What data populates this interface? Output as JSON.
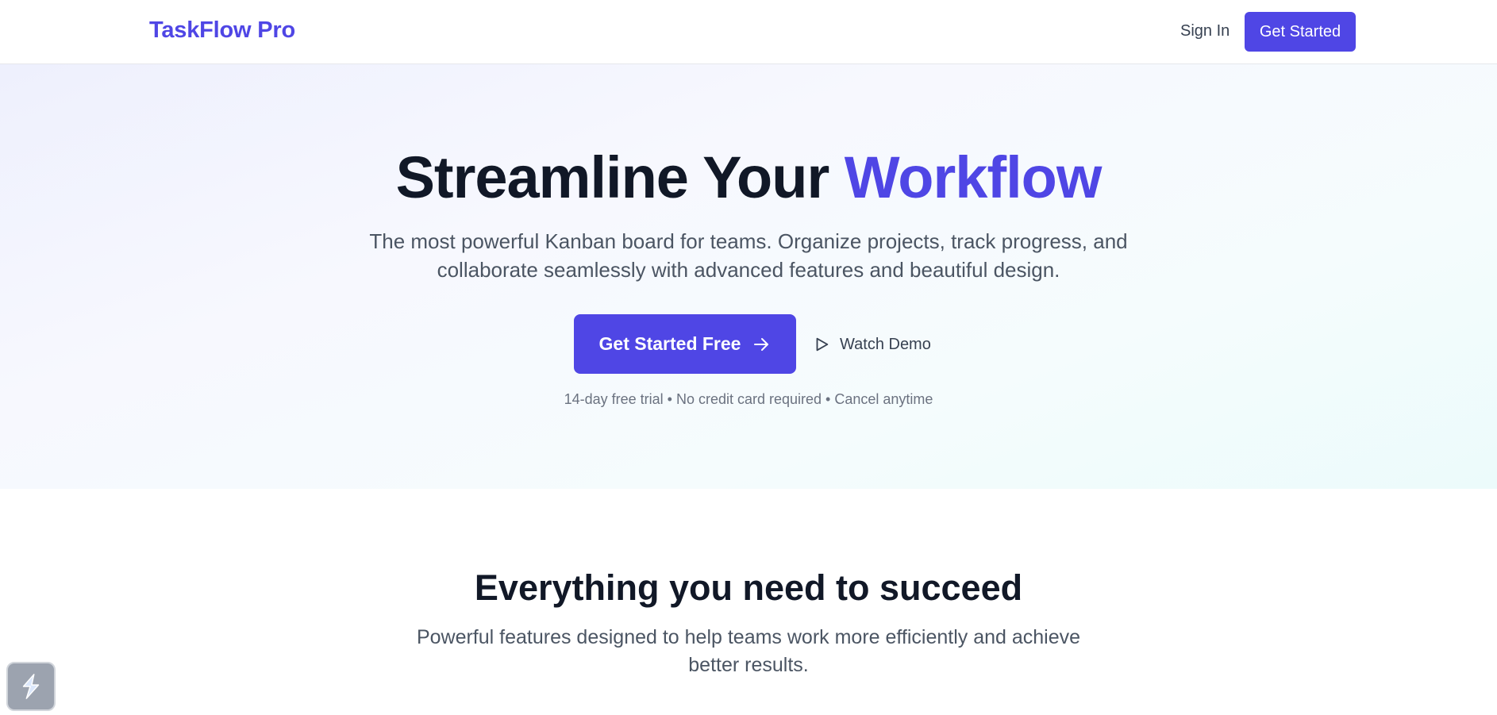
{
  "header": {
    "brand": "TaskFlow Pro",
    "sign_in_label": "Sign In",
    "get_started_label": "Get Started"
  },
  "hero": {
    "title_main": "Streamline Your ",
    "title_accent": "Workflow",
    "subtitle": "The most powerful Kanban board for teams. Organize projects, track progress, and collaborate seamlessly with advanced features and beautiful design.",
    "primary_cta_label": "Get Started Free",
    "primary_cta_icon": "arrow-right-icon",
    "demo_label": "Watch Demo",
    "demo_icon": "play-icon",
    "trial_note": "14-day free trial • No credit card required • Cancel anytime"
  },
  "features": {
    "title": "Everything you need to succeed",
    "subtitle": "Powerful features designed to help teams work more efficiently and achieve better results."
  },
  "widget": {
    "icon": "lightning-logo-icon"
  },
  "colors": {
    "brand": "#4f46e5",
    "heading": "#111827",
    "body_text": "#4b5563",
    "muted_text": "#6b7280"
  }
}
